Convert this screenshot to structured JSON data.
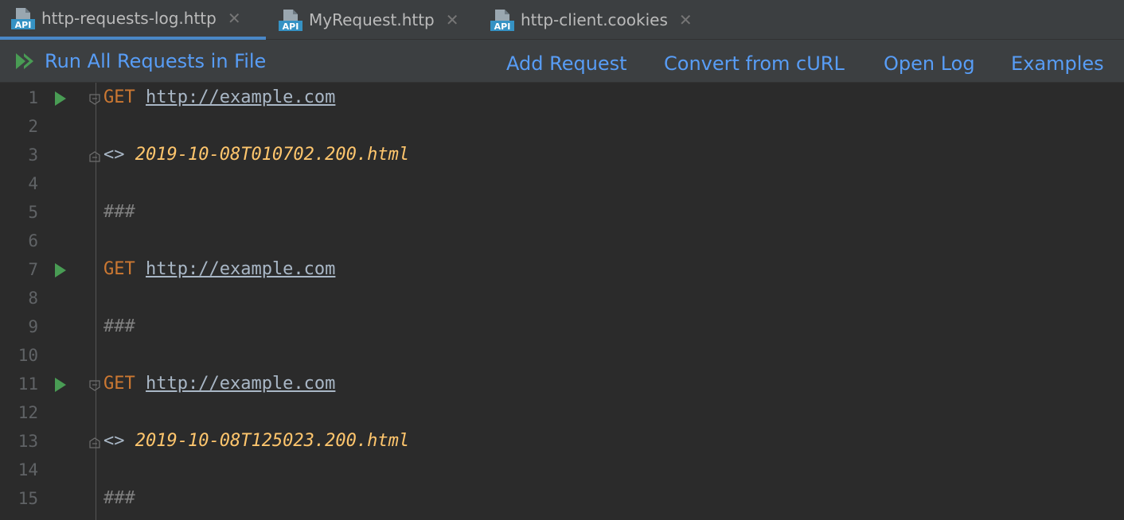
{
  "tabs": [
    {
      "label": "http-requests-log.http",
      "icon": "api-file-icon",
      "active": true
    },
    {
      "label": "MyRequest.http",
      "icon": "api-file-icon",
      "active": false
    },
    {
      "label": "http-client.cookies",
      "icon": "api-file-icon",
      "active": false
    }
  ],
  "icon_badge": "API",
  "close_glyph": "✕",
  "toolbar": {
    "run_all": "Run All Requests in File",
    "add_request": "Add Request",
    "convert_curl": "Convert from cURL",
    "open_log": "Open Log",
    "examples": "Examples"
  },
  "colors": {
    "accent": "#589df6",
    "keyword": "#cc7832",
    "filename": "#ffc66d",
    "run_green": "#499c54",
    "active_tab_underline": "#4a88c7"
  },
  "editor": {
    "lines": [
      {
        "num": "1",
        "method": "GET",
        "url": "http://example.com"
      },
      {
        "num": "2"
      },
      {
        "num": "3",
        "marker": "<>",
        "file": "2019-10-08T010702.200.html"
      },
      {
        "num": "4"
      },
      {
        "num": "5",
        "sep": "###"
      },
      {
        "num": "6"
      },
      {
        "num": "7",
        "method": "GET",
        "url": "http://example.com"
      },
      {
        "num": "8"
      },
      {
        "num": "9",
        "sep": "###"
      },
      {
        "num": "10"
      },
      {
        "num": "11",
        "method": "GET",
        "url": "http://example.com"
      },
      {
        "num": "12"
      },
      {
        "num": "13",
        "marker": "<>",
        "file": "2019-10-08T125023.200.html"
      },
      {
        "num": "14"
      },
      {
        "num": "15",
        "sep": "###"
      }
    ]
  }
}
